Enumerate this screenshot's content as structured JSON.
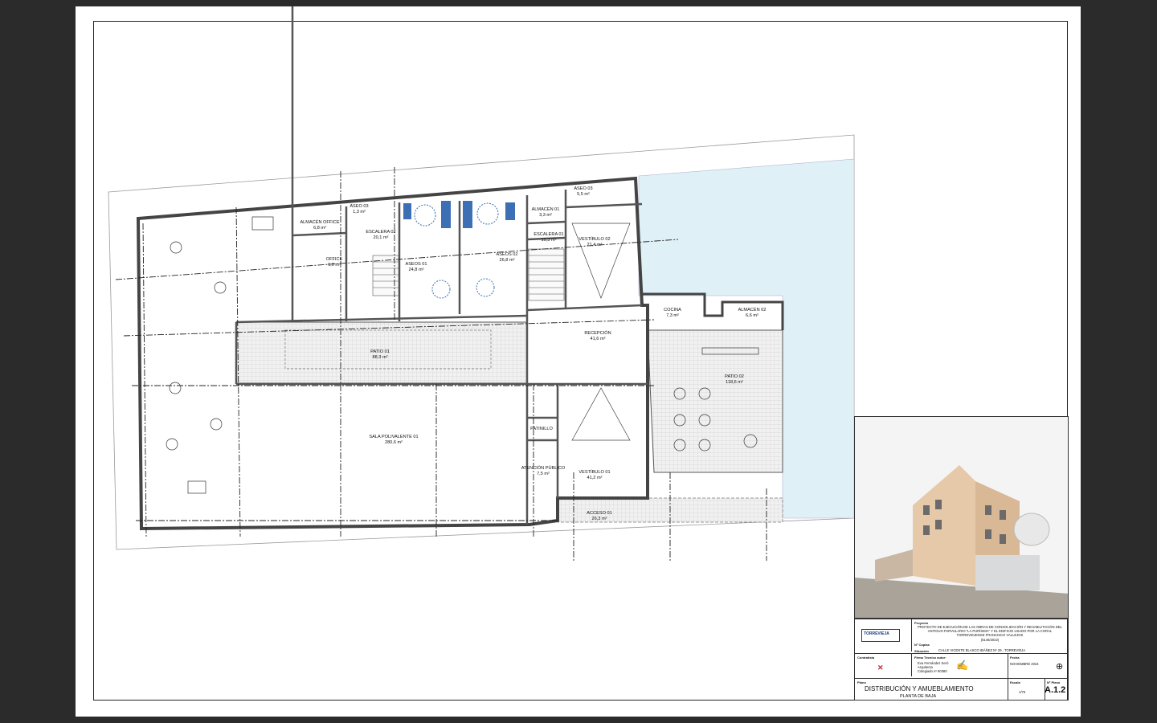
{
  "rooms": [
    {
      "id": "almacen-office",
      "name": "ALMACÉN OFFICE",
      "area": "6,8 m²"
    },
    {
      "id": "aseo-03",
      "name": "ASEO 03",
      "area": "1,3 m²"
    },
    {
      "id": "escalera-02",
      "name": "ESCALERA 02",
      "area": "20,1 m²"
    },
    {
      "id": "office",
      "name": "OFFICE",
      "area": "6,0 m²"
    },
    {
      "id": "aseos-01",
      "name": "ASEOS 01",
      "area": "24,8 m²"
    },
    {
      "id": "aseos-02",
      "name": "ASEOS 02",
      "area": "26,8 m²"
    },
    {
      "id": "almacen-01",
      "name": "ALMACÉN 01",
      "area": "3,3 m²"
    },
    {
      "id": "escalera-01",
      "name": "ESCALERA 01",
      "area": "10,3 m²"
    },
    {
      "id": "aseo-03b",
      "name": "ASEO 03",
      "area": "5,5 m²"
    },
    {
      "id": "vestibulo-02",
      "name": "VESTÍBULO 02",
      "area": "21,4 m²"
    },
    {
      "id": "cocina",
      "name": "COCINA",
      "area": "7,3 m²"
    },
    {
      "id": "almacen-02",
      "name": "ALMACÉN 02",
      "area": "6,6 m²"
    },
    {
      "id": "patio-01",
      "name": "PATIO 01",
      "area": "88,3 m²"
    },
    {
      "id": "recepcion",
      "name": "RECEPCIÓN",
      "area": "41,6 m²"
    },
    {
      "id": "patio-02",
      "name": "PATIO 02",
      "area": "118,6 m²"
    },
    {
      "id": "sala-polivalente-01",
      "name": "SALA POLIVALENTE 01",
      "area": "280,6 m²"
    },
    {
      "id": "patinillo",
      "name": "PATINILLO",
      "area": ""
    },
    {
      "id": "atencion-publico",
      "name": "ATENCIÓN PÚBLICO",
      "area": "7,5 m²"
    },
    {
      "id": "vestibulo-01",
      "name": "VESTÍBULO 01",
      "area": "41,2 m²"
    },
    {
      "id": "acceso-01",
      "name": "ACCESO 01",
      "area": "26,3 m²"
    }
  ],
  "title_block": {
    "proyecto_label": "Proyecto",
    "proyecto_text": "PROYECTO DE EJECUCIÓN DE LAS OBRAS DE CONSOLIDACIÓN Y REHABILITACIÓN DEL ANTIGUO PARVULARIO \"LA PURÍSIMA\" Y EL EDIFICIO USADO POR LA CORAL TORREVIEJENSE FRANCISCO VALLEJOS",
    "expediente": "(6146/2022)",
    "copias_label": "Nº Copias",
    "situacion_label": "Situación",
    "situacion_text": "CALLE VICENTE BLASCO IBÁÑEZ Nº 29 , TORREVIEJA",
    "client_logo": "TORREVIEJA",
    "contratista_label": "Contratista",
    "firma_label": "Firma Técnico autor:",
    "autor_nombre": "Eva Fernández Seró",
    "autor_cargo": "Arquitecta",
    "autor_colegiado": "Colegiado nº 90380",
    "fecha_label": "Fecha",
    "fecha": "NOVIEMBRE 2024",
    "plano_label": "Plano",
    "plano_titulo": "DISTRIBUCIÓN Y AMUEBLAMIENTO",
    "plano_subtitulo": "PLANTA DE BAJA",
    "escala_label": "Escala",
    "escala": "1/75",
    "num_plano_label": "Nº Plano",
    "num_plano": "A.1.2"
  },
  "colors": {
    "sheet_bg": "#2b2b2b",
    "water": "#dff0f7",
    "wall": "#555555",
    "paving": "#e8e8e8"
  }
}
